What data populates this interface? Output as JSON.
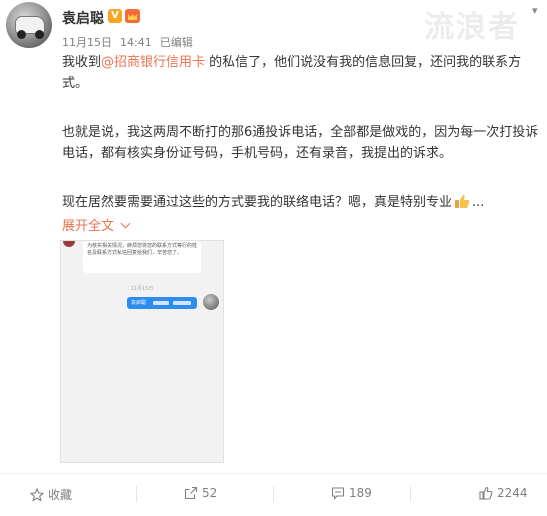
{
  "author": {
    "name": "袁启聪",
    "verified_badge": "V"
  },
  "meta": {
    "date": "11月15日",
    "time": "14:41",
    "edited": "已编辑"
  },
  "watermark": "流浪者",
  "post": {
    "p1_before": "我收到",
    "p1_mention": "@招商银行信用卡",
    "p1_after": " 的私信了，他们说没有我的信息回复，还问我的联系方式。",
    "p2": "也就是说，我这两周不断打的那6通投诉电话，全部都是做戏的，因为每一次打投诉电话，都有核实身份证号码，手机号码，还有录音，我提出的诉求。",
    "p3": "现在居然要需要通过这些的方式要我的联络电话？嗯，真是特别专业",
    "p3_ellipsis": "..."
  },
  "expand_label": "展开全文",
  "screenshot": {
    "incoming_message": "为核实相关情况，麻烦您将您的联系方式等行的姓名及联系方式私信回复给我们，辛苦您了。",
    "timestamp": "11月15日",
    "outgoing_name": "袁启聪"
  },
  "actions": {
    "favorite": "收藏",
    "repost": "52",
    "comment": "189",
    "like": "2244"
  },
  "icons": {
    "favorite": "star-icon",
    "repost": "share-icon",
    "comment": "comment-icon",
    "like": "thumbs-up-icon",
    "thumb_emoji": "thumbs-up-emoji-icon",
    "expand": "chevron-down-icon",
    "menu": "chevron-down-icon"
  },
  "colors": {
    "accent": "#eb7350",
    "meta": "#808080",
    "bubble_out": "#2d8cf0",
    "verified": "#f5a623"
  }
}
